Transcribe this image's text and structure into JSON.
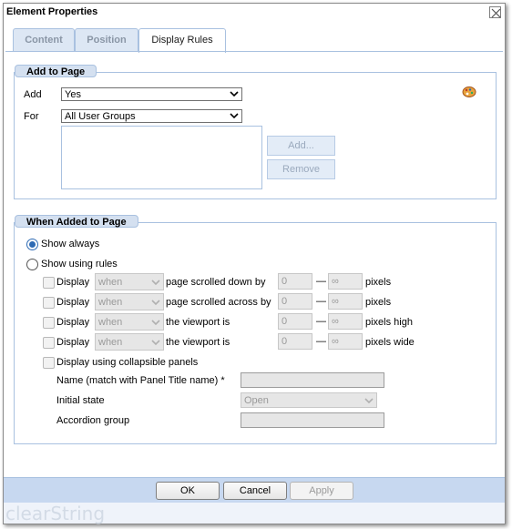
{
  "window": {
    "title": "Element Properties"
  },
  "tabs": [
    {
      "label": "Content",
      "active": false
    },
    {
      "label": "Position",
      "active": false
    },
    {
      "label": "Display Rules",
      "active": true
    }
  ],
  "add_to_page": {
    "legend": "Add to Page",
    "add_label": "Add",
    "add_value": "Yes",
    "for_label": "For",
    "for_value": "All User Groups",
    "add_button": "Add...",
    "remove_button": "Remove",
    "icon": "rules-icon"
  },
  "when_added": {
    "legend": "When Added to Page",
    "show_always": "Show always",
    "show_using_rules": "Show using rules",
    "rules": [
      {
        "display": "Display",
        "when": "when",
        "condition": "page scrolled down by",
        "from": "0",
        "to": "∞",
        "unit": "pixels"
      },
      {
        "display": "Display",
        "when": "when",
        "condition": "page scrolled across by",
        "from": "0",
        "to": "∞",
        "unit": "pixels"
      },
      {
        "display": "Display",
        "when": "when",
        "condition": "the viewport is",
        "from": "0",
        "to": "∞",
        "unit": "pixels high"
      },
      {
        "display": "Display",
        "when": "when",
        "condition": "the viewport is",
        "from": "0",
        "to": "∞",
        "unit": "pixels wide"
      }
    ],
    "dash": "—",
    "collapsible": "Display using collapsible panels",
    "name_label": "Name (match with Panel Title name) *",
    "initial_state_label": "Initial state",
    "initial_state_value": "Open",
    "accordion_label": "Accordion group"
  },
  "footer": {
    "ok": "OK",
    "cancel": "Cancel",
    "apply": "Apply"
  },
  "brand": "clearString",
  "colors": {
    "accent": "#2e6bb4",
    "panel": "#c7d8f0",
    "border": "#a9c1e0"
  }
}
